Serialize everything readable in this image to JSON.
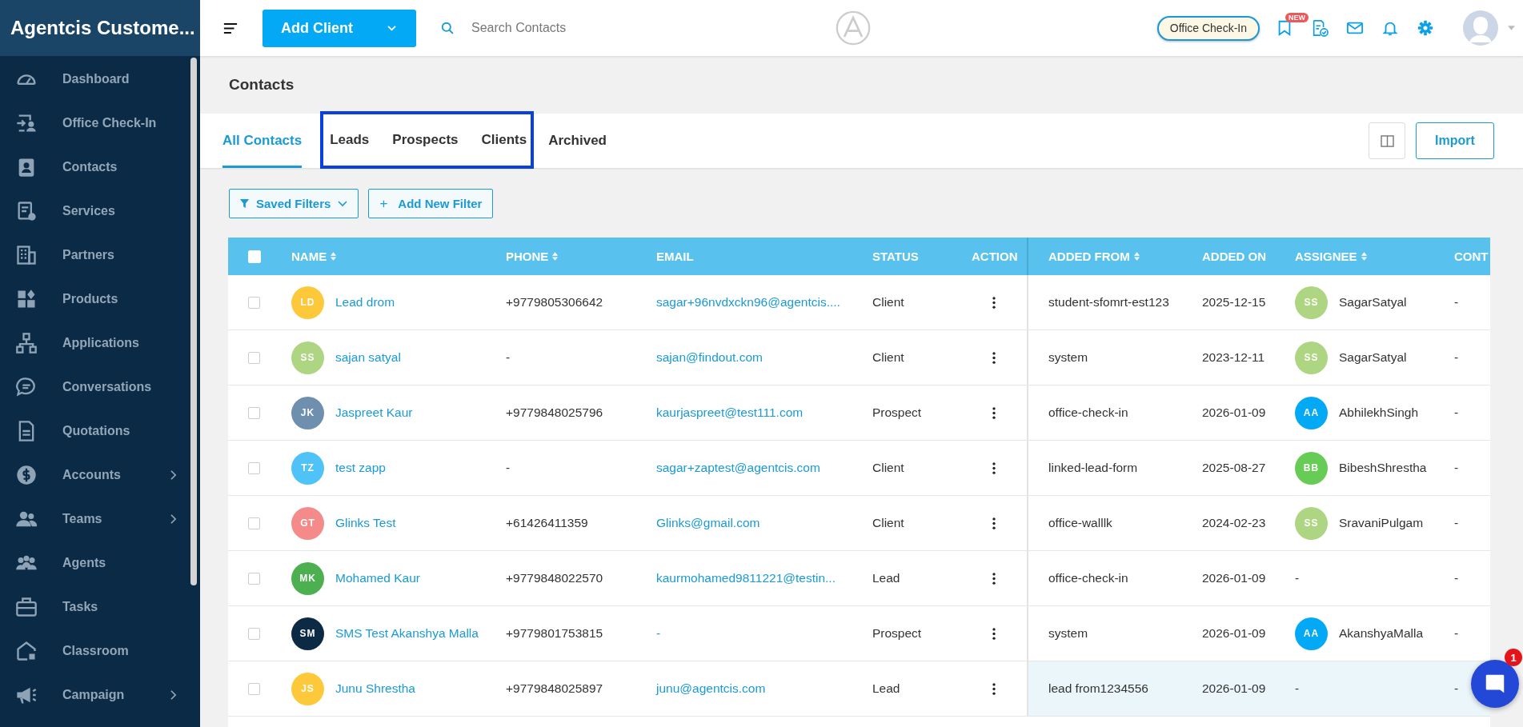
{
  "app": {
    "title": "Agentcis Custome..."
  },
  "sidebar": {
    "items": [
      {
        "label": "Dashboard",
        "expandable": false
      },
      {
        "label": "Office Check-In",
        "expandable": false
      },
      {
        "label": "Contacts",
        "expandable": false
      },
      {
        "label": "Services",
        "expandable": false
      },
      {
        "label": "Partners",
        "expandable": false
      },
      {
        "label": "Products",
        "expandable": false
      },
      {
        "label": "Applications",
        "expandable": false
      },
      {
        "label": "Conversations",
        "expandable": false
      },
      {
        "label": "Quotations",
        "expandable": false
      },
      {
        "label": "Accounts",
        "expandable": true
      },
      {
        "label": "Teams",
        "expandable": true
      },
      {
        "label": "Agents",
        "expandable": false
      },
      {
        "label": "Tasks",
        "expandable": false
      },
      {
        "label": "Classroom",
        "expandable": false
      },
      {
        "label": "Campaign",
        "expandable": true
      }
    ]
  },
  "topbar": {
    "add_button": "Add Client",
    "search": {
      "placeholder": "Search Contacts"
    },
    "checkin_button": "Office Check-In",
    "new_badge": "NEW"
  },
  "page": {
    "title": "Contacts"
  },
  "tabs": [
    {
      "label": "All Contacts",
      "selected": true,
      "highlighted": false
    },
    {
      "label": "Leads",
      "selected": false,
      "highlighted": true
    },
    {
      "label": "Prospects",
      "selected": false,
      "highlighted": true
    },
    {
      "label": "Clients",
      "selected": false,
      "highlighted": true
    },
    {
      "label": "Archived",
      "selected": false,
      "highlighted": false
    }
  ],
  "import_button": "Import",
  "filters": {
    "saved": "Saved Filters",
    "add": "Add New Filter",
    "add_icon": "+"
  },
  "table": {
    "select_all_checked": false,
    "columns": [
      {
        "label": "NAME",
        "sortable": true
      },
      {
        "label": "PHONE",
        "sortable": true
      },
      {
        "label": "EMAIL",
        "sortable": false
      },
      {
        "label": "STATUS",
        "sortable": false
      },
      {
        "label": "ACTION",
        "sortable": false
      },
      {
        "label": "ADDED FROM",
        "sortable": true
      },
      {
        "label": "ADDED ON",
        "sortable": false
      },
      {
        "label": "ASSIGNEE",
        "sortable": true
      },
      {
        "label": "CONT",
        "sortable": false
      }
    ],
    "rows": [
      {
        "checked": false,
        "hovered": false,
        "initials": "LD",
        "color": "#fdc93a",
        "name": "Lead drom",
        "phone": "+9779805306642",
        "email": "sagar+96nvdxckn96@agentcis....",
        "status": "Client",
        "added_from": "student-sfomrt-est123",
        "added_on": "2025-12-15",
        "assignee": {
          "initials": "SS",
          "color": "#aed581",
          "name": "SagarSatyal"
        },
        "column_9": "-"
      },
      {
        "checked": false,
        "hovered": false,
        "initials": "SS",
        "color": "#aed581",
        "name": "sajan satyal",
        "phone": "-",
        "email": "sajan@findout.com",
        "status": "Client",
        "added_from": "system",
        "added_on": "2023-12-11",
        "assignee": {
          "initials": "SS",
          "color": "#aed581",
          "name": "SagarSatyal"
        },
        "column_9": "-"
      },
      {
        "checked": false,
        "hovered": false,
        "initials": "JK",
        "color": "#6f8fae",
        "name": "Jaspreet Kaur",
        "phone": "+9779848025796",
        "email": "kaurjaspreet@test111.com",
        "status": "Prospect",
        "added_from": "office-check-in",
        "added_on": "2026-01-09",
        "assignee": {
          "initials": "AA",
          "color": "#03a9f4",
          "name": "AbhilekhSingh"
        },
        "column_9": "-"
      },
      {
        "checked": false,
        "hovered": false,
        "initials": "TZ",
        "color": "#4fc3f7",
        "name": "test zapp",
        "phone": "-",
        "email": "sagar+zaptest@agentcis.com",
        "status": "Client",
        "added_from": "linked-lead-form",
        "added_on": "2025-08-27",
        "assignee": {
          "initials": "BB",
          "color": "#66cc55",
          "name": "BibeshShrestha"
        },
        "column_9": "-"
      },
      {
        "checked": false,
        "hovered": false,
        "initials": "GT",
        "color": "#f48a8a",
        "name": "Glinks Test",
        "phone": "+61426411359",
        "email": "Glinks@gmail.com",
        "status": "Client",
        "added_from": "office-walllk",
        "added_on": "2024-02-23",
        "assignee": {
          "initials": "SS",
          "color": "#aed581",
          "name": "SravaniPulgam"
        },
        "column_9": "-"
      },
      {
        "checked": false,
        "hovered": false,
        "initials": "MK",
        "color": "#4caf50",
        "name": "Mohamed Kaur",
        "phone": "+9779848022570",
        "email": "kaurmohamed9811221@testin...",
        "status": "Lead",
        "added_from": "office-check-in",
        "added_on": "2026-01-09",
        "assignee": {
          "name": "-"
        },
        "column_9": "-"
      },
      {
        "checked": false,
        "hovered": false,
        "initials": "SM",
        "color": "#0d2a44",
        "name": "SMS Test Akanshya Malla",
        "phone": "+9779801753815",
        "email": "-",
        "status": "Prospect",
        "added_from": "system",
        "added_on": "2026-01-09",
        "assignee": {
          "initials": "AA",
          "color": "#03a9f4",
          "name": "AkanshyaMalla"
        },
        "column_9": "-"
      },
      {
        "checked": false,
        "hovered": true,
        "initials": "JS",
        "color": "#fdc93a",
        "name": "Junu Shrestha",
        "phone": "+9779848025897",
        "email": "junu@agentcis.com",
        "status": "Lead",
        "added_from": "lead from1234556",
        "added_on": "2026-01-09",
        "assignee": {
          "name": "-"
        },
        "column_9": "-"
      }
    ]
  },
  "chat": {
    "unread": "1"
  }
}
